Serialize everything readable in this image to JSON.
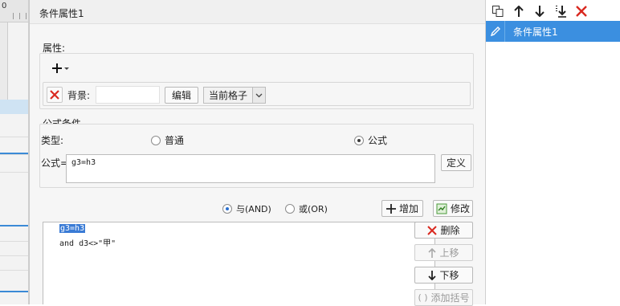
{
  "dialog": {
    "title": "条件属性1",
    "attributes": {
      "section_label": "属性:",
      "add_icon": "plus-dropdown-icon",
      "background_label": "背景:",
      "background_value": "",
      "edit_button": "编辑",
      "scope_select": "当前格子"
    },
    "formula_condition": {
      "section_label": "公式条件",
      "type_label": "类型:",
      "type_options": [
        "普通",
        "公式"
      ],
      "type_selected": "公式",
      "formula_label": "公式=",
      "formula_value": "g3=h3",
      "define_button": "定义"
    },
    "logic": {
      "and_label": "与(AND)",
      "or_label": "或(OR)",
      "selected": "与(AND)",
      "add_button": "增加",
      "modify_button": "修改"
    },
    "conditions_list": [
      "g3=h3",
      "and d3<>\"甲\""
    ],
    "selected_condition": "g3=h3",
    "side_buttons": {
      "delete": "删除",
      "move_up": "上移",
      "move_down": "下移",
      "add_bracket": "添加括号"
    }
  },
  "right_panel": {
    "toolbar_icons": [
      "copy-icon",
      "arrow-up-icon",
      "arrow-down-icon",
      "move-to-bottom-icon",
      "delete-x-icon"
    ],
    "items": [
      {
        "label": "条件属性1",
        "icon": "pencil-icon",
        "selected": true
      }
    ]
  },
  "background_editor": {
    "corner_label": "0"
  },
  "colors": {
    "selection_blue": "#3b8fe0",
    "delete_red": "#d9281f",
    "list_selection": "#3a7bd5"
  }
}
